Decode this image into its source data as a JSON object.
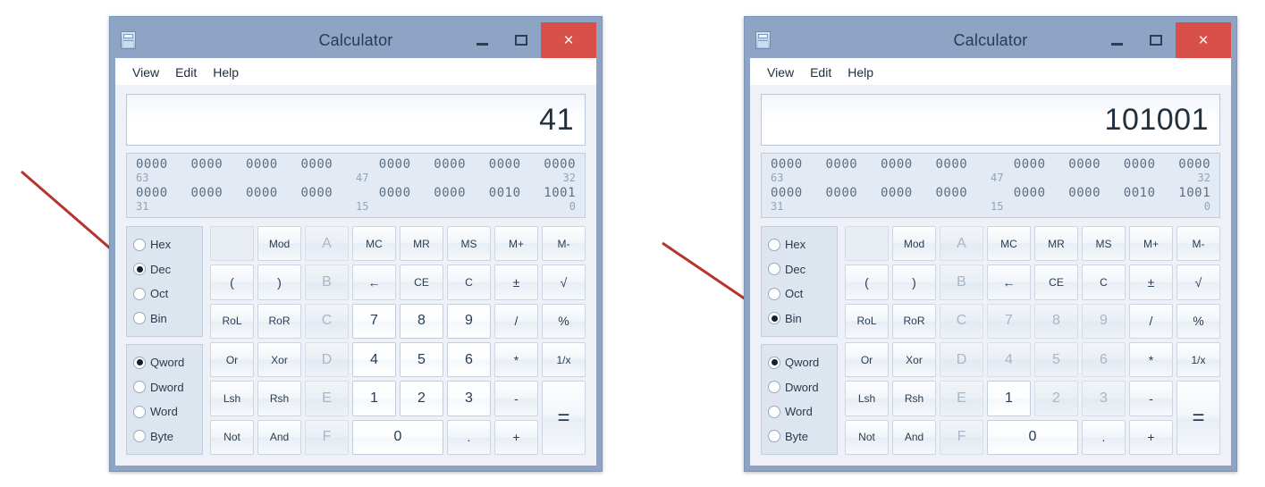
{
  "windows": [
    {
      "id": "left",
      "title": "Calculator",
      "icon": "calculator-icon",
      "controls": {
        "minimize": "–",
        "maximize": "□",
        "close": "×"
      },
      "menu": [
        "View",
        "Edit",
        "Help"
      ],
      "display_value": "41",
      "bits": {
        "row1": [
          "0000",
          "0000",
          "0000",
          "0000",
          "0000",
          "0000",
          "0000",
          "0000"
        ],
        "row1_labels": {
          "left": "63",
          "mid": "47",
          "right": "32"
        },
        "row2": [
          "0000",
          "0000",
          "0000",
          "0000",
          "0000",
          "0000",
          "0010",
          "1001"
        ],
        "row2_labels": {
          "left": "31",
          "mid": "15",
          "right": "0"
        }
      },
      "base_options": [
        "Hex",
        "Dec",
        "Oct",
        "Bin"
      ],
      "base_selected": "Dec",
      "width_options": [
        "Qword",
        "Dword",
        "Word",
        "Byte"
      ],
      "width_selected": "Qword",
      "disabled_keys": [
        "A",
        "B",
        "C",
        "D",
        "E",
        "F"
      ]
    },
    {
      "id": "right",
      "title": "Calculator",
      "icon": "calculator-icon",
      "controls": {
        "minimize": "–",
        "maximize": "□",
        "close": "×"
      },
      "menu": [
        "View",
        "Edit",
        "Help"
      ],
      "display_value": "101001",
      "bits": {
        "row1": [
          "0000",
          "0000",
          "0000",
          "0000",
          "0000",
          "0000",
          "0000",
          "0000"
        ],
        "row1_labels": {
          "left": "63",
          "mid": "47",
          "right": "32"
        },
        "row2": [
          "0000",
          "0000",
          "0000",
          "0000",
          "0000",
          "0000",
          "0010",
          "1001"
        ],
        "row2_labels": {
          "left": "31",
          "mid": "15",
          "right": "0"
        }
      },
      "base_options": [
        "Hex",
        "Dec",
        "Oct",
        "Bin"
      ],
      "base_selected": "Bin",
      "width_options": [
        "Qword",
        "Dword",
        "Word",
        "Byte"
      ],
      "width_selected": "Qword",
      "disabled_keys": [
        "A",
        "B",
        "C",
        "D",
        "E",
        "F",
        "2",
        "3",
        "4",
        "5",
        "6",
        "7",
        "8",
        "9"
      ]
    }
  ],
  "keypad": [
    {
      "label": "",
      "kind": "blank"
    },
    {
      "label": "Mod",
      "kind": "small"
    },
    {
      "label": "A",
      "kind": "hex"
    },
    {
      "label": "MC",
      "kind": "small"
    },
    {
      "label": "MR",
      "kind": "small"
    },
    {
      "label": "MS",
      "kind": "small"
    },
    {
      "label": "M+",
      "kind": "small"
    },
    {
      "label": "M-",
      "kind": "small"
    },
    {
      "label": "(",
      "kind": "op"
    },
    {
      "label": ")",
      "kind": "op"
    },
    {
      "label": "B",
      "kind": "hex"
    },
    {
      "label": "←",
      "kind": "op"
    },
    {
      "label": "CE",
      "kind": "small"
    },
    {
      "label": "C",
      "kind": "small"
    },
    {
      "label": "±",
      "kind": "op"
    },
    {
      "label": "√",
      "kind": "op"
    },
    {
      "label": "RoL",
      "kind": "small"
    },
    {
      "label": "RoR",
      "kind": "small"
    },
    {
      "label": "C",
      "kind": "hex"
    },
    {
      "label": "7",
      "kind": "digit"
    },
    {
      "label": "8",
      "kind": "digit"
    },
    {
      "label": "9",
      "kind": "digit"
    },
    {
      "label": "/",
      "kind": "op"
    },
    {
      "label": "%",
      "kind": "op"
    },
    {
      "label": "Or",
      "kind": "small"
    },
    {
      "label": "Xor",
      "kind": "small"
    },
    {
      "label": "D",
      "kind": "hex"
    },
    {
      "label": "4",
      "kind": "digit"
    },
    {
      "label": "5",
      "kind": "digit"
    },
    {
      "label": "6",
      "kind": "digit"
    },
    {
      "label": "*",
      "kind": "op"
    },
    {
      "label": "1/x",
      "kind": "small"
    },
    {
      "label": "Lsh",
      "kind": "small"
    },
    {
      "label": "Rsh",
      "kind": "small"
    },
    {
      "label": "E",
      "kind": "hex"
    },
    {
      "label": "1",
      "kind": "digit"
    },
    {
      "label": "2",
      "kind": "digit"
    },
    {
      "label": "3",
      "kind": "digit"
    },
    {
      "label": "-",
      "kind": "op"
    },
    {
      "label": "=",
      "kind": "equals"
    },
    {
      "label": "Not",
      "kind": "small"
    },
    {
      "label": "And",
      "kind": "small"
    },
    {
      "label": "F",
      "kind": "hex"
    },
    {
      "label": "0",
      "kind": "zero"
    },
    {
      "label": ".",
      "kind": "op"
    },
    {
      "label": "+",
      "kind": "op"
    }
  ],
  "annotations": {
    "arrow_color": "#c0392b",
    "left_arrow_target": "Dec",
    "right_arrow_target": "Bin"
  }
}
